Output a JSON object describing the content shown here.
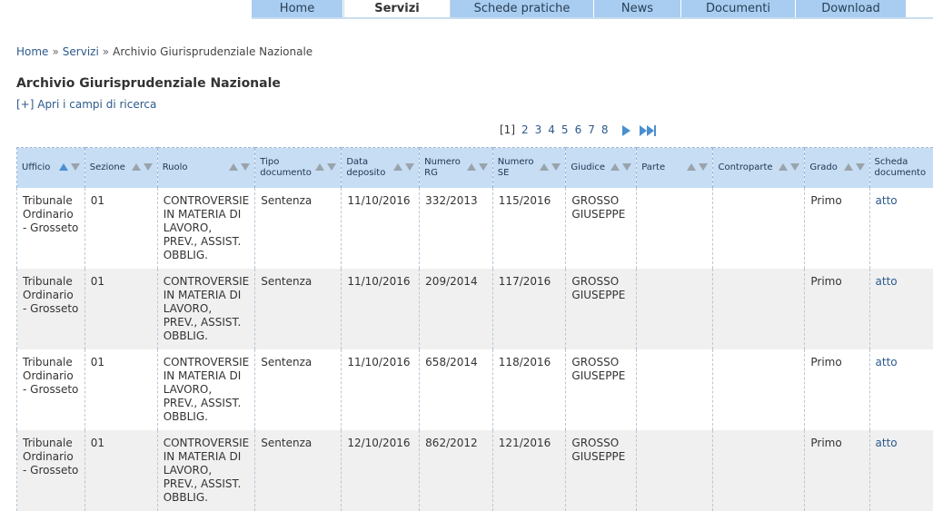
{
  "nav": {
    "tabs": [
      {
        "label": "Home",
        "active": false
      },
      {
        "label": "Servizi",
        "active": true
      },
      {
        "label": "Schede pratiche",
        "active": false
      },
      {
        "label": "News",
        "active": false
      },
      {
        "label": "Documenti",
        "active": false
      },
      {
        "label": "Download",
        "active": false
      }
    ]
  },
  "breadcrumb": {
    "home": "Home",
    "servizi": "Servizi",
    "current": "Archivio Giurisprudenziale Nazionale",
    "separator": "»"
  },
  "page_title": "Archivio Giurisprudenziale Nazionale",
  "open_fields_link": "[+] Apri i campi di ricerca",
  "pager": {
    "current": "[1]",
    "pages": [
      "2",
      "3",
      "4",
      "5",
      "6",
      "7",
      "8"
    ]
  },
  "table": {
    "columns": [
      {
        "l1": "Ufficio",
        "l2": "",
        "sort": true,
        "active": true
      },
      {
        "l1": "Sezione",
        "l2": "",
        "sort": true,
        "active": false
      },
      {
        "l1": "Ruolo",
        "l2": "",
        "sort": true,
        "active": false
      },
      {
        "l1": "Tipo",
        "l2": "documento",
        "sort": true,
        "active": false
      },
      {
        "l1": "Data",
        "l2": "deposito",
        "sort": true,
        "active": false
      },
      {
        "l1": "Numero",
        "l2": "RG",
        "sort": true,
        "active": false
      },
      {
        "l1": "Numero",
        "l2": "SE",
        "sort": true,
        "active": false
      },
      {
        "l1": "Giudice",
        "l2": "",
        "sort": true,
        "active": false
      },
      {
        "l1": "Parte",
        "l2": "",
        "sort": true,
        "active": false
      },
      {
        "l1": "Controparte",
        "l2": "",
        "sort": true,
        "active": false
      },
      {
        "l1": "Grado",
        "l2": "",
        "sort": true,
        "active": false
      },
      {
        "l1": "Scheda",
        "l2": "documento",
        "sort": false,
        "active": false
      }
    ],
    "rows": [
      {
        "ufficio": "Tribunale Ordinario - Grosseto",
        "sezione": "01",
        "ruolo": "CONTROVERSIE IN MATERIA DI LAVORO, PREV., ASSIST. OBBLIG.",
        "tipo": "Sentenza",
        "data": "11/10/2016",
        "rg": "332/2013",
        "se": "115/2016",
        "giudice": "GROSSO GIUSEPPE",
        "parte": "",
        "controparte": "",
        "grado": "Primo",
        "scheda": "atto"
      },
      {
        "ufficio": "Tribunale Ordinario - Grosseto",
        "sezione": "01",
        "ruolo": "CONTROVERSIE IN MATERIA DI LAVORO, PREV., ASSIST. OBBLIG.",
        "tipo": "Sentenza",
        "data": "11/10/2016",
        "rg": "209/2014",
        "se": "117/2016",
        "giudice": "GROSSO GIUSEPPE",
        "parte": "",
        "controparte": "",
        "grado": "Primo",
        "scheda": "atto"
      },
      {
        "ufficio": "Tribunale Ordinario - Grosseto",
        "sezione": "01",
        "ruolo": "CONTROVERSIE IN MATERIA DI LAVORO, PREV., ASSIST. OBBLIG.",
        "tipo": "Sentenza",
        "data": "11/10/2016",
        "rg": "658/2014",
        "se": "118/2016",
        "giudice": "GROSSO GIUSEPPE",
        "parte": "",
        "controparte": "",
        "grado": "Primo",
        "scheda": "atto"
      },
      {
        "ufficio": "Tribunale Ordinario - Grosseto",
        "sezione": "01",
        "ruolo": "CONTROVERSIE IN MATERIA DI LAVORO, PREV., ASSIST. OBBLIG.",
        "tipo": "Sentenza",
        "data": "12/10/2016",
        "rg": "862/2012",
        "se": "121/2016",
        "giudice": "GROSSO GIUSEPPE",
        "parte": "",
        "controparte": "",
        "grado": "Primo",
        "scheda": "atto"
      }
    ]
  }
}
